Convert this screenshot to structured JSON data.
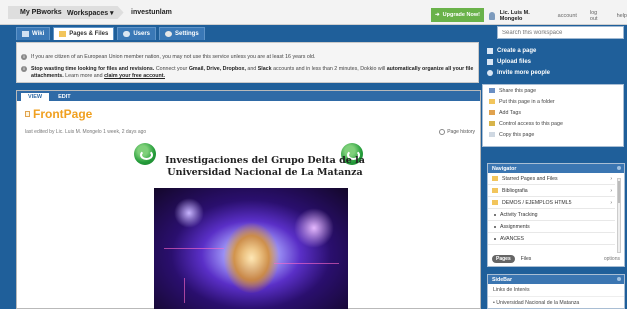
{
  "topbar": {
    "home": "My PBworks",
    "workspaces": "Workspaces ▾",
    "workspace_name": "investunlam",
    "upgrade": "Upgrade Now!",
    "user_name": "Lic. Luis M. Mongelo",
    "account": "account",
    "logout": "log out",
    "help": "help"
  },
  "tabs": [
    {
      "label": "Wiki",
      "active": false
    },
    {
      "label": "Pages & Files",
      "active": true
    },
    {
      "label": "Users",
      "active": false
    },
    {
      "label": "Settings",
      "active": false
    }
  ],
  "search": {
    "placeholder": "Search this workspace"
  },
  "notices": {
    "eu": "If you are citizen of an European Union member nation, you may not use this service unless you are at least 16 years old.",
    "dokkio_bold": "Stop wasting time looking for files and revisions.",
    "dokkio_text1": "Connect your",
    "dokkio_services": "Gmail, Drive, Dropbox,",
    "dokkio_and": "and",
    "dokkio_slack": "Slack",
    "dokkio_text2": "accounts and in less than 2 minutes, Dokkio will",
    "dokkio_bold2": "automatically organize all your file attachments.",
    "dokkio_learn": "Learn more and",
    "dokkio_claim": "claim your free account."
  },
  "page": {
    "view_tab": "VIEW",
    "edit_tab": "EDIT",
    "title": "FrontPage",
    "edited": "last edited by  Lic. Luis M. Mongelo 1 week, 2 days ago",
    "history": "Page history",
    "heading_line1": "Investigaciones del Grupo Delta de la",
    "heading_line2": "Universidad Nacional de La Matanza"
  },
  "side_actions": [
    "Create a page",
    "Upload files",
    "Invite more people"
  ],
  "page_menu": [
    "Share this page",
    "Put this page in a folder",
    "Add Tags",
    "Control access to this page",
    "Copy this page"
  ],
  "navigator": {
    "title": "Navigator",
    "items": [
      {
        "label": "Starred Pages and Files",
        "icon": "star-icon",
        "arrow": true
      },
      {
        "label": "Bibliografia",
        "icon": "folder-icon",
        "arrow": true
      },
      {
        "label": "DEMOS / EJEMPLOS HTML5",
        "icon": "folder-icon",
        "arrow": true
      },
      {
        "label": "Activity Tracking",
        "icon": "bullet",
        "arrow": false
      },
      {
        "label": "Assignments",
        "icon": "bullet",
        "arrow": false
      },
      {
        "label": "AVANCES",
        "icon": "bullet",
        "arrow": false
      }
    ],
    "pages_pill": "Pages",
    "files": "Files",
    "options": "options"
  },
  "sidebar": {
    "title": "SideBar",
    "line1": "Links de Interés",
    "line2": "• Universidad Nacional de la Matanza"
  },
  "colors": {
    "accent": "#1f5f9a",
    "upgrade": "#6ab24a",
    "title": "#f0a020"
  }
}
